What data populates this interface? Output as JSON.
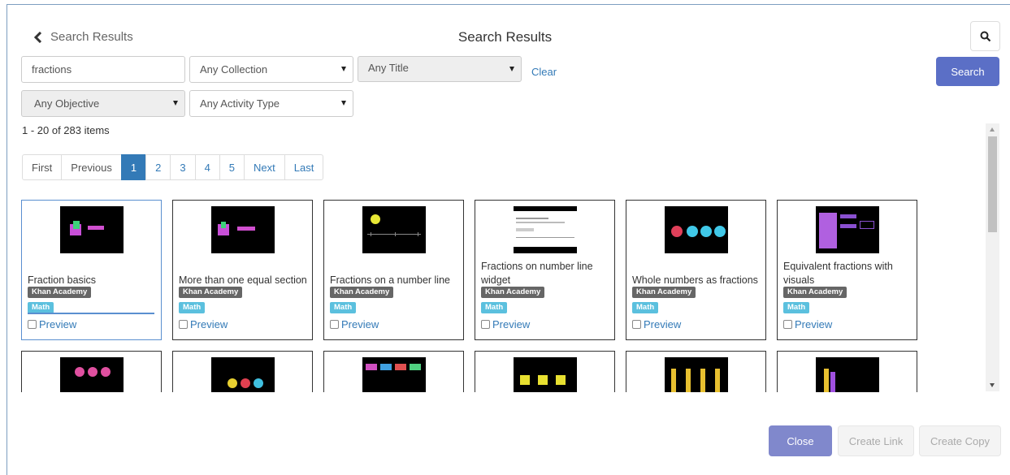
{
  "header": {
    "back_label": "Search Results",
    "title": "Search Results"
  },
  "filters": {
    "query": "fractions",
    "collection": "Any Collection",
    "title_filter": "Any Title",
    "objective": "Any Objective",
    "activity_type": "Any Activity Type",
    "clear_label": "Clear",
    "search_label": "Search"
  },
  "results_count": "1 - 20 of 283 items",
  "pagination": {
    "first": "First",
    "previous": "Previous",
    "pages": [
      "1",
      "2",
      "3",
      "4",
      "5"
    ],
    "current": "1",
    "next": "Next",
    "last": "Last"
  },
  "results": [
    {
      "title": "Fraction basics",
      "source": "Khan Academy",
      "subject": "Math",
      "preview": "Preview",
      "selected": true
    },
    {
      "title": "More than one equal section",
      "source": "Khan Academy",
      "subject": "Math",
      "preview": "Preview"
    },
    {
      "title": "Fractions on a number line",
      "source": "Khan Academy",
      "subject": "Math",
      "preview": "Preview"
    },
    {
      "title": "Fractions on number line widget",
      "source": "Khan Academy",
      "subject": "Math",
      "preview": "Preview"
    },
    {
      "title": "Whole numbers as fractions",
      "source": "Khan Academy",
      "subject": "Math",
      "preview": "Preview"
    },
    {
      "title": "Equivalent fractions with visuals",
      "source": "Khan Academy",
      "subject": "Math",
      "preview": "Preview"
    }
  ],
  "footer": {
    "close_label": "Close",
    "create_link_label": "Create Link",
    "create_copy_label": "Create Copy"
  },
  "colors": {
    "primary": "#5b6fc6",
    "link": "#337ab7",
    "source_tag": "#666666",
    "subject_tag": "#5bc0de"
  }
}
